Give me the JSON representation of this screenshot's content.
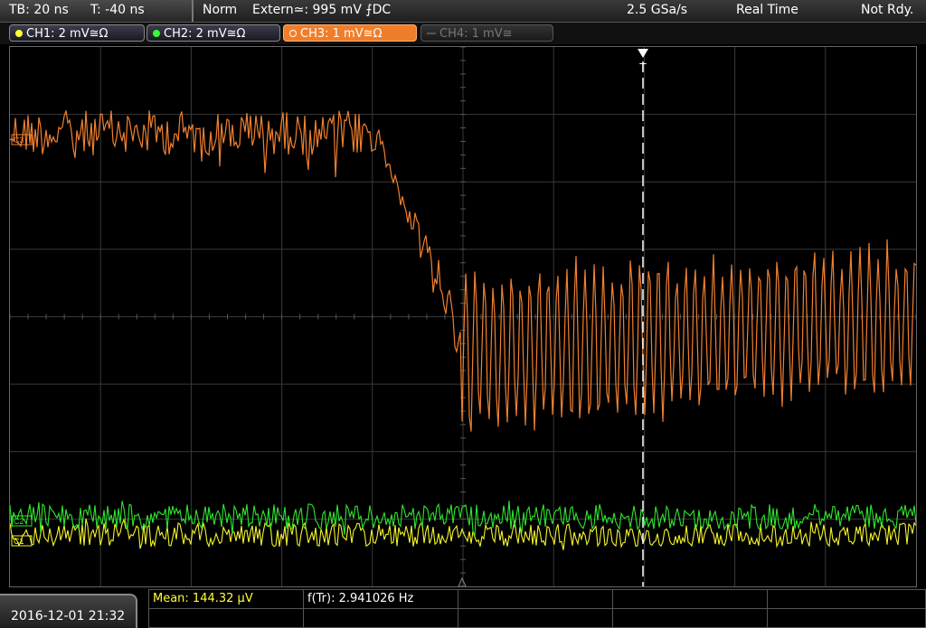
{
  "status": {
    "timebase": "TB: 20 ns",
    "trigger_time": "T: -40 ns",
    "mode": "Norm",
    "trigger_source": "Extern≃: 995 mV ⨍DC",
    "sample_rate": "2.5 GSa/s",
    "acquisition": "Real Time",
    "state": "Not Rdy."
  },
  "channels": [
    {
      "label": "CH1: 2 mV≅Ω",
      "color": "#ffff33",
      "active": false,
      "enabled": true
    },
    {
      "label": "CH2: 2 mV≅Ω",
      "color": "#33ff33",
      "active": false,
      "enabled": true
    },
    {
      "label": "CH3: 1 mV≅Ω",
      "color": "#ff8030",
      "active": true,
      "enabled": true
    },
    {
      "label": "CH4: 1 mV≅",
      "color": "#777777",
      "active": false,
      "enabled": false
    }
  ],
  "markers": {
    "ch3": "C3",
    "ch2": "C2",
    "ch1": "C1",
    "trigger": "T"
  },
  "measurements": {
    "mean": "Mean: 144.32 µV",
    "freq": "f(Tr): 2.941026 Hz"
  },
  "datetime": "2016-12-01 21:32",
  "colors": {
    "ch1": "#f5f52a",
    "ch2": "#2ee62e",
    "ch3": "#f08030",
    "grid": "#3a3a3a",
    "meas_text": "#ffff33"
  }
}
